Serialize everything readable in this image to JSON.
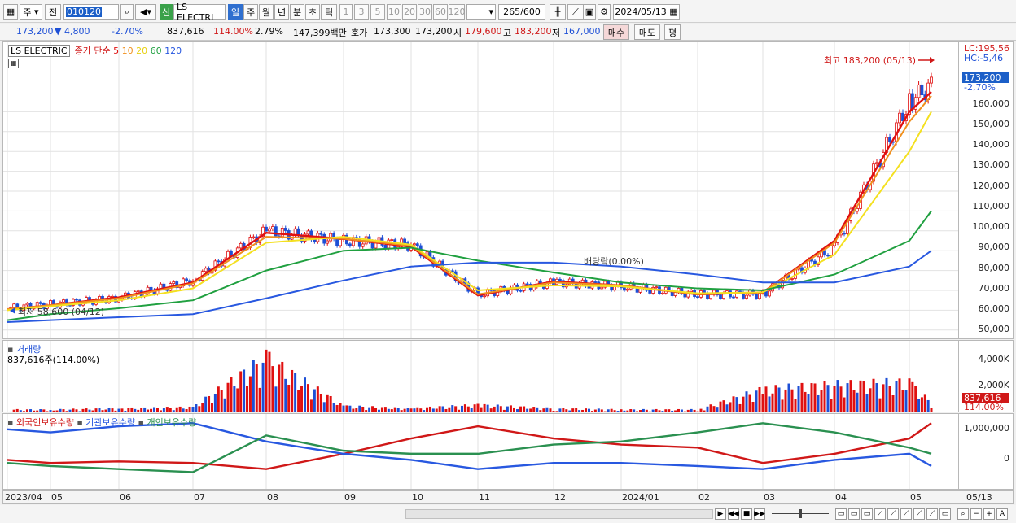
{
  "toolbar": {
    "market": "주",
    "prev_label": "전",
    "code": "010120",
    "stock_name": "LS ELECTRI",
    "new_badge": "신",
    "period_tabs": [
      "일",
      "주",
      "월",
      "년",
      "분",
      "초",
      "틱"
    ],
    "active_period": "일",
    "intervals": [
      "1",
      "3",
      "5",
      "10",
      "20",
      "30",
      "60",
      "120"
    ],
    "count": "265",
    "count_total": "/600",
    "date": "2024/05/13"
  },
  "quote": {
    "price": "173,200",
    "change": "▼    4,800",
    "change_pct": "-2.70%",
    "volume": "837,616",
    "volume_ratio": "114.00%",
    "turnover": "2.79%",
    "amount": "147,399백만",
    "bid_label": "호가",
    "bid": "173,300",
    "ask": "173,200",
    "open_label": "시",
    "open": "179,600",
    "high_label": "고",
    "high": "183,200",
    "low_label": "저",
    "low": "167,000",
    "buy_label": "매수",
    "sell_label": "매도",
    "eval_label": "평"
  },
  "price_panel": {
    "stock_label": "LS ELECTRIC",
    "ma_title": "종가 단순",
    "ma_periods": [
      "5",
      "10",
      "20",
      "60",
      "120"
    ],
    "ma_colors": [
      "#e01010",
      "#f0901e",
      "#f4e020",
      "#20a040",
      "#2858e0"
    ],
    "high_note": "최고 183,200 (05/13)",
    "low_note": "최저 58,600 (04/12)",
    "event_note": "배당락(0.00%)",
    "lc": "LC:195,56",
    "hc": "HC:-5,46",
    "last_price": "173,200",
    "last_pct": "-2,70%",
    "y_ticks": [
      "160,000",
      "150,000",
      "140,000",
      "130,000",
      "120,000",
      "110,000",
      "100,000",
      "90,000",
      "80,000",
      "70,000",
      "60,000",
      "50,000"
    ]
  },
  "volume_panel": {
    "title": "거래량",
    "current": "837,616주(114.00%)",
    "y_ticks": [
      "4,000K",
      "2,000K"
    ],
    "last_value": "837,616",
    "last_pct": "114.00%"
  },
  "holding_panel": {
    "series": [
      "외국인보유수량",
      "기관보유수량",
      "개인보유수량"
    ],
    "colors": [
      "#d01818",
      "#2858e0",
      "#2a9050"
    ],
    "y_ticks": [
      "1,000,000",
      "0"
    ]
  },
  "date_axis": [
    "2023/04",
    "05",
    "06",
    "07",
    "08",
    "09",
    "10",
    "11",
    "12",
    "2024/01",
    "02",
    "03",
    "04",
    "05"
  ],
  "date_axis_right": "05/13",
  "chart_data": [
    {
      "type": "candlestick",
      "title": "LS ELECTRIC",
      "x": [
        "2023/04",
        "05",
        "06",
        "07",
        "08",
        "09",
        "10",
        "11",
        "12",
        "2024/01",
        "02",
        "03",
        "04",
        "05",
        "05/13"
      ],
      "series": [
        {
          "name": "종가",
          "values": [
            61000,
            63000,
            66000,
            75000,
            100000,
            95000,
            93000,
            68000,
            74000,
            72000,
            68000,
            68000,
            92000,
            165000,
            173200
          ]
        },
        {
          "name": "5",
          "values": [
            60500,
            62500,
            66500,
            74000,
            99000,
            96000,
            92000,
            67500,
            74500,
            72500,
            68000,
            69000,
            95000,
            160000,
            170000
          ]
        },
        {
          "name": "10",
          "values": [
            60500,
            62500,
            66000,
            73500,
            97000,
            96000,
            92500,
            68000,
            74000,
            72500,
            68000,
            69000,
            94000,
            155000,
            168000
          ]
        },
        {
          "name": "20",
          "values": [
            60000,
            62000,
            65000,
            71000,
            94000,
            97000,
            93000,
            70000,
            72500,
            72000,
            68500,
            69000,
            88000,
            140000,
            160000
          ]
        },
        {
          "name": "60",
          "values": [
            55000,
            58000,
            61000,
            65000,
            80000,
            90000,
            91500,
            85000,
            79000,
            74000,
            71000,
            70000,
            78000,
            95000,
            110000
          ]
        },
        {
          "name": "120",
          "values": [
            54000,
            55000,
            56500,
            58000,
            66000,
            75000,
            82000,
            84000,
            84000,
            82000,
            78000,
            74000,
            74000,
            82000,
            90000
          ]
        }
      ],
      "ylim": [
        45000,
        195000
      ],
      "y_ticks": [
        160000,
        150000,
        140000,
        130000,
        120000,
        110000,
        100000,
        90000,
        80000,
        70000,
        60000,
        50000
      ],
      "annotations": [
        "최고 183,200 (05/13)",
        "최저 58,600 (04/12)",
        "배당락(0.00%)"
      ]
    },
    {
      "type": "bar",
      "title": "거래량",
      "x": [
        "2023/04",
        "05",
        "06",
        "07",
        "08",
        "09",
        "10",
        "11",
        "12",
        "2024/01",
        "02",
        "03",
        "04",
        "05",
        "05/13"
      ],
      "values": [
        300,
        300,
        400,
        500,
        4600,
        600,
        400,
        700,
        400,
        300,
        300,
        2000,
        2400,
        2600,
        838
      ],
      "ylabel": "K",
      "ylim": [
        0,
        5000
      ]
    },
    {
      "type": "line",
      "x": [
        "2023/04",
        "05",
        "06",
        "07",
        "08",
        "09",
        "10",
        "11",
        "12",
        "2024/01",
        "02",
        "03",
        "04",
        "05",
        "05/13"
      ],
      "series": [
        {
          "name": "외국인보유수량",
          "values": [
            -200000,
            -300000,
            -250000,
            -300000,
            -500000,
            0,
            500000,
            900000,
            500000,
            300000,
            200000,
            -300000,
            0,
            500000,
            1000000
          ]
        },
        {
          "name": "기관보유수량",
          "values": [
            800000,
            700000,
            900000,
            1000000,
            400000,
            0,
            -200000,
            -500000,
            -300000,
            -300000,
            -400000,
            -500000,
            -200000,
            0,
            -400000
          ]
        },
        {
          "name": "개인보유수량",
          "values": [
            -300000,
            -400000,
            -500000,
            -600000,
            600000,
            100000,
            0,
            0,
            300000,
            400000,
            700000,
            1000000,
            700000,
            200000,
            0
          ]
        }
      ],
      "y_ticks": [
        1000000,
        0
      ]
    }
  ]
}
